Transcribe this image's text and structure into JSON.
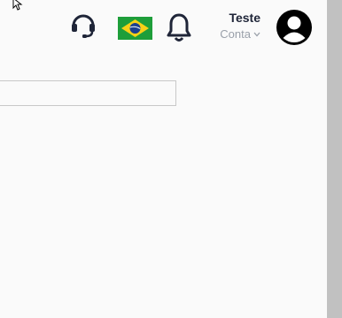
{
  "header": {
    "user": {
      "name": "Teste",
      "account_label": "Conta"
    },
    "icons": {
      "support": "headset-icon",
      "language": "brazil-flag-icon",
      "notifications": "bell-icon",
      "profile": "user-avatar-icon",
      "account_menu": "chevron-down-icon"
    }
  },
  "search": {
    "value": "",
    "placeholder": ""
  },
  "colors": {
    "background": "#fafafa",
    "icon_dark": "#1f2538",
    "muted_text": "#9aa0aa",
    "scrollbar_thumb": "#c1c1c1"
  }
}
